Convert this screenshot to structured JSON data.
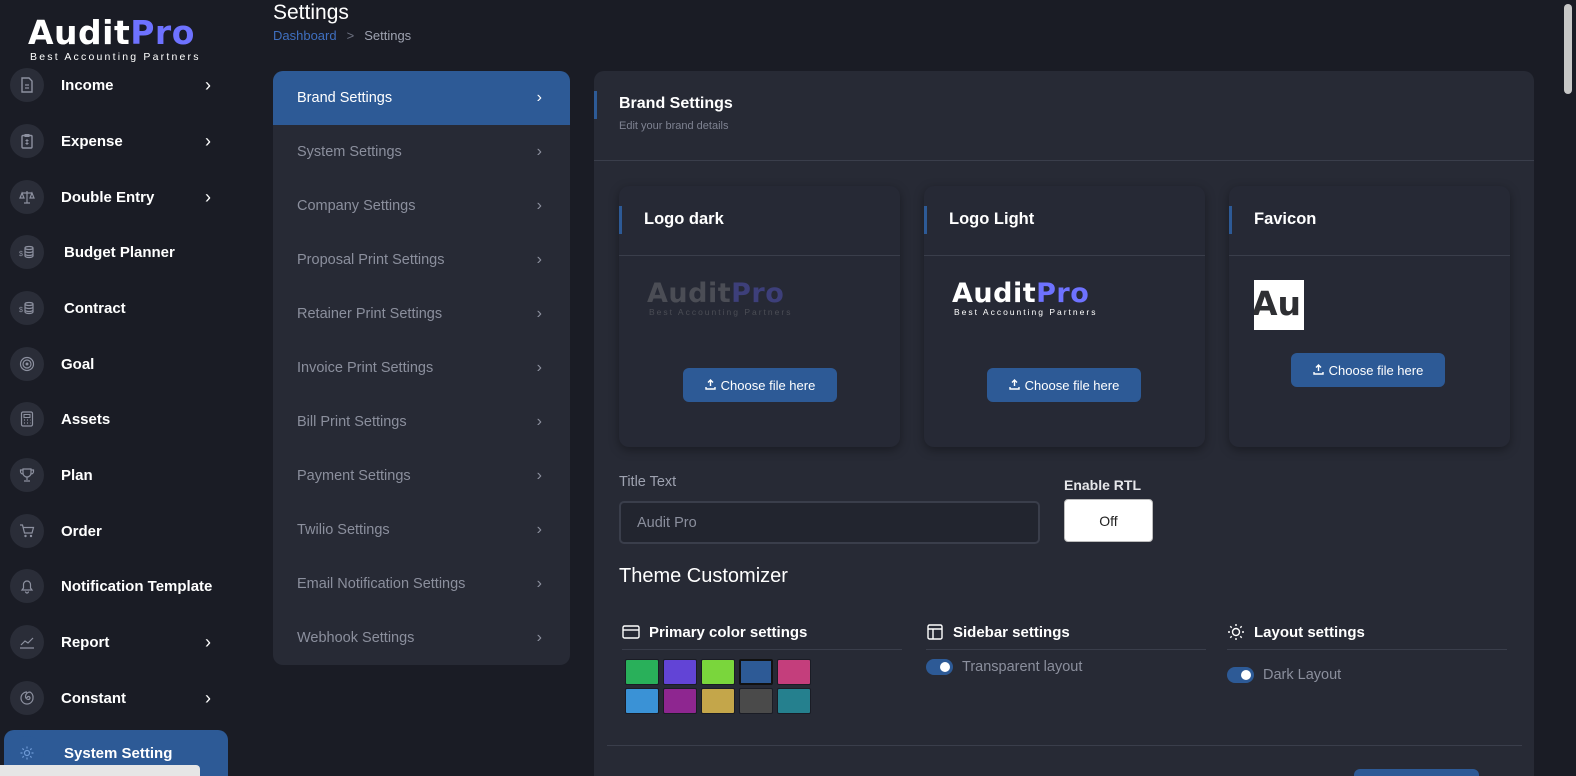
{
  "brand": {
    "name_part1": "Audit",
    "name_part2": "Pro",
    "tagline": "Best Accounting Partners"
  },
  "sidebar": {
    "items": [
      {
        "label": "Income",
        "icon": "document-icon",
        "has_submenu": true
      },
      {
        "label": "Expense",
        "icon": "clipboard-icon",
        "has_submenu": true
      },
      {
        "label": "Double Entry",
        "icon": "scale-icon",
        "has_submenu": true
      },
      {
        "label": "Budget Planner",
        "icon": "coins-icon",
        "has_submenu": false
      },
      {
        "label": "Contract",
        "icon": "coins-icon",
        "has_submenu": false
      },
      {
        "label": "Goal",
        "icon": "target-icon",
        "has_submenu": false
      },
      {
        "label": "Assets",
        "icon": "calculator-icon",
        "has_submenu": false
      },
      {
        "label": "Plan",
        "icon": "trophy-icon",
        "has_submenu": false
      },
      {
        "label": "Order",
        "icon": "cart-icon",
        "has_submenu": false
      },
      {
        "label": "Notification Template",
        "icon": "bell-icon",
        "has_submenu": false
      },
      {
        "label": "Report",
        "icon": "chart-line-icon",
        "has_submenu": true
      },
      {
        "label": "Constant",
        "icon": "spiral-icon",
        "has_submenu": true
      },
      {
        "label": "System Setting",
        "icon": "gear-icon",
        "has_submenu": false,
        "active": true
      }
    ]
  },
  "header": {
    "title": "Settings",
    "breadcrumb": {
      "link": "Dashboard",
      "separator": ">",
      "current": "Settings"
    }
  },
  "settings_menu": {
    "items": [
      {
        "label": "Brand Settings",
        "active": true
      },
      {
        "label": "System Settings"
      },
      {
        "label": "Company Settings"
      },
      {
        "label": "Proposal Print Settings"
      },
      {
        "label": "Retainer Print Settings"
      },
      {
        "label": "Invoice Print Settings"
      },
      {
        "label": "Bill Print Settings"
      },
      {
        "label": "Payment Settings"
      },
      {
        "label": "Twilio Settings"
      },
      {
        "label": "Email Notification Settings"
      },
      {
        "label": "Webhook Settings"
      }
    ]
  },
  "panel": {
    "title": "Brand Settings",
    "subtitle": "Edit your brand details",
    "cards": [
      {
        "title": "Logo dark",
        "button": "Choose file here"
      },
      {
        "title": "Logo Light",
        "button": "Choose file here"
      },
      {
        "title": "Favicon",
        "button": "Choose file here",
        "favicon_text": "Au"
      }
    ],
    "title_text": {
      "label": "Title Text",
      "value": "Audit Pro"
    },
    "rtl": {
      "label": "Enable RTL",
      "value": "Off"
    },
    "theme": {
      "title": "Theme Customizer",
      "primary": {
        "title": "Primary color settings",
        "colors": [
          "#29b05a",
          "#6244d6",
          "#7ad63c",
          "#2d5a96",
          "#c43e7c",
          "#3a92d6",
          "#8e2690",
          "#c4a64a",
          "#4a4a4a",
          "#25808e"
        ],
        "selected": "#2d5a96"
      },
      "sidebar": {
        "title": "Sidebar settings",
        "toggle_label": "Transparent layout",
        "toggle_on": true
      },
      "layout": {
        "title": "Layout settings",
        "toggle_label": "Dark Layout",
        "toggle_on": true
      }
    }
  },
  "colors": {
    "accent": "#2d5a96",
    "brand_blue": "#6e72ff",
    "background": "#1a1c25",
    "card": "#272a35"
  }
}
